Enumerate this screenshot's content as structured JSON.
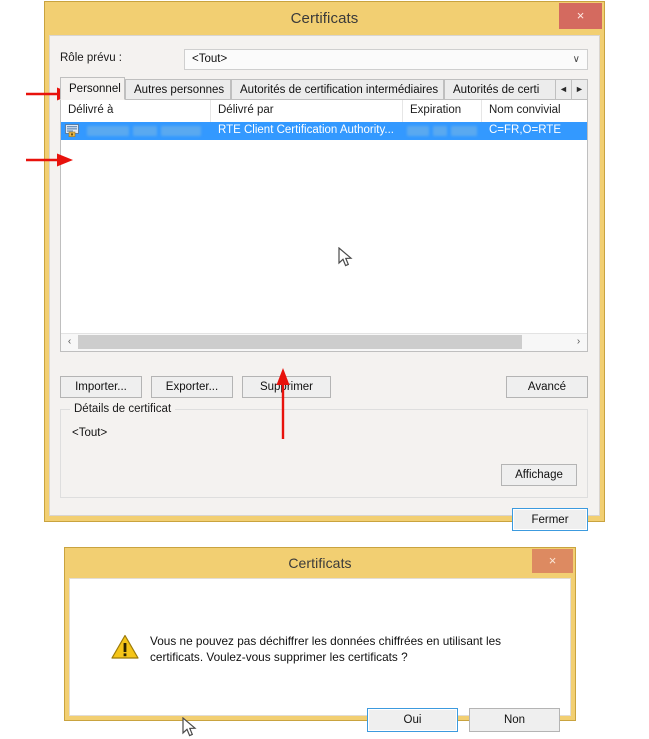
{
  "main_dialog": {
    "title": "Certificats",
    "close_label": "×",
    "role": {
      "label": "Rôle prévu :",
      "value": "<Tout>",
      "arrow": "∨"
    },
    "tabs": [
      {
        "label": "Personnel",
        "active": true
      },
      {
        "label": "Autres personnes",
        "active": false
      },
      {
        "label": "Autorités de certification intermédiaires",
        "active": false
      },
      {
        "label": "Autorités de certi",
        "active": false
      }
    ],
    "tab_scroll": {
      "prev": "◄",
      "next": "►"
    },
    "list": {
      "columns": [
        "Délivré à",
        "Délivré par",
        "Expiration",
        "Nom convivial"
      ],
      "rows": [
        {
          "issued_to": "",
          "issued_to_redacted": true,
          "issued_by": "RTE Client Certification Authority...",
          "expiration": "",
          "expiration_redacted": true,
          "friendly_name": "C=FR,O=RTE",
          "selected": true,
          "icon": "certificate-icon"
        }
      ],
      "scroll_left": "‹",
      "scroll_right": "›"
    },
    "buttons": {
      "import": "Importer...",
      "export": "Exporter...",
      "remove": "Supprimer",
      "advanced": "Avancé",
      "close": "Fermer"
    },
    "details_group": {
      "title": "Détails de certificat",
      "value": "<Tout>",
      "view_button": "Affichage"
    }
  },
  "confirm_dialog": {
    "title": "Certificats",
    "close_label": "×",
    "icon": "warning-icon",
    "message": "Vous ne pouvez pas déchiffrer les données chiffrées en utilisant les certificats. Voulez-vous supprimer les certificats ?",
    "yes_label": "Oui",
    "no_label": "Non"
  },
  "annotations": {
    "arrow_color": "#e8120c",
    "arrows": [
      {
        "name": "arrow-to-personnel-tab"
      },
      {
        "name": "arrow-to-certificate-row"
      },
      {
        "name": "arrow-to-supprimer-button"
      }
    ],
    "cursors": [
      {
        "name": "cursor-in-list"
      },
      {
        "name": "cursor-in-confirm-dialog"
      }
    ]
  },
  "colors": {
    "title_bar": "#f2cf72",
    "close_button": "#d46a5f",
    "selection": "#3399ff",
    "dialog_body": "#f4f2f0",
    "focus_border": "#3c9ade"
  }
}
